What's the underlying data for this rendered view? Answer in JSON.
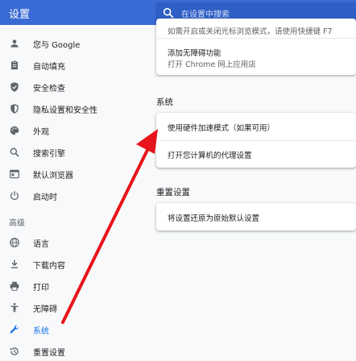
{
  "header": {
    "title": "设置",
    "search_placeholder": "在设置中搜索"
  },
  "sidebar": {
    "items": [
      {
        "label": "您与 Google",
        "icon": "person-icon"
      },
      {
        "label": "自动填充",
        "icon": "clipboard-icon"
      },
      {
        "label": "安全检查",
        "icon": "shield-check-icon"
      },
      {
        "label": "隐私设置和安全性",
        "icon": "shield-lock-icon"
      },
      {
        "label": "外观",
        "icon": "palette-icon"
      },
      {
        "label": "搜索引擎",
        "icon": "search-icon"
      },
      {
        "label": "默认浏览器",
        "icon": "browser-window-icon"
      },
      {
        "label": "启动时",
        "icon": "power-icon"
      }
    ],
    "advanced_label": "高级",
    "advanced_items": [
      {
        "label": "语言",
        "icon": "globe-icon"
      },
      {
        "label": "下载内容",
        "icon": "download-icon"
      },
      {
        "label": "打印",
        "icon": "printer-icon"
      },
      {
        "label": "无障碍",
        "icon": "accessibility-icon"
      },
      {
        "label": "系统",
        "icon": "wrench-icon",
        "active": true
      },
      {
        "label": "重置设置",
        "icon": "history-icon"
      }
    ]
  },
  "main": {
    "accessibility_card": {
      "partial_text": "如需开启或关闭光标浏览模式，请使用快捷键 F7",
      "add_features_title": "添加无障碍功能",
      "add_features_sub": "打开 Chrome 网上应用店"
    },
    "system_section": {
      "title": "系统",
      "hardware_accel": "使用硬件加速模式（如果可用）",
      "proxy": "打开您计算机的代理设置"
    },
    "reset_section": {
      "title": "重置设置",
      "restore": "将设置还原为原始默认设置"
    }
  },
  "colors": {
    "header": "#3a6bd4",
    "accent": "#1a73e8",
    "annotation_arrow": "#e8141b"
  }
}
